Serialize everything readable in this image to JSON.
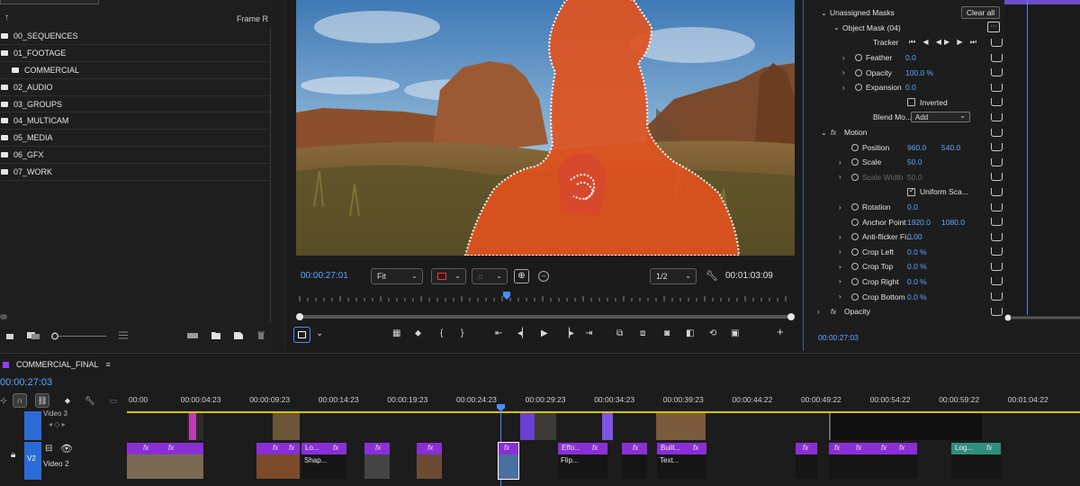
{
  "project": {
    "column_header": "Frame R",
    "bins": [
      {
        "name": "00_SEQUENCES",
        "child": false
      },
      {
        "name": "01_FOOTAGE",
        "child": false
      },
      {
        "name": "COMMERCIAL",
        "child": true
      },
      {
        "name": "02_AUDIO",
        "child": false
      },
      {
        "name": "03_GROUPS",
        "child": false
      },
      {
        "name": "04_MULTICAM",
        "child": false
      },
      {
        "name": "05_MEDIA",
        "child": false
      },
      {
        "name": "06_GFX",
        "child": false
      },
      {
        "name": "07_WORK",
        "child": false
      }
    ]
  },
  "monitor": {
    "current_tc": "00:00:27:01",
    "duration_tc": "00:01:03:09",
    "zoom": "Fit",
    "resolution": "1/2"
  },
  "effects": {
    "clear_all": "Clear all",
    "rows": [
      {
        "twirl": "down",
        "label": "Unassigned Masks",
        "indent": 4
      },
      {
        "twirl": "down",
        "label": "Object Mask (04)",
        "indent": 18
      },
      {
        "label": "Tracker",
        "indent": 52,
        "tracker": true
      },
      {
        "twirl": "right",
        "stop": true,
        "label": "Feather",
        "value": "0.0",
        "indent": 42,
        "vx": 98
      },
      {
        "twirl": "right",
        "stop": true,
        "label": "Opacity",
        "value": "100.0 %",
        "indent": 42,
        "vx": 98
      },
      {
        "twirl": "right",
        "stop": true,
        "label": "Expansion",
        "value": "0.0",
        "indent": 42,
        "vx": 98
      },
      {
        "check": "off",
        "label": "Inverted",
        "indent": 114
      },
      {
        "label": "Blend Mo...",
        "indent": 52,
        "blend": "Add"
      },
      {
        "twirl": "down",
        "fx": true,
        "label": "Motion",
        "indent": 4
      },
      {
        "stop": true,
        "label": "Position",
        "value": "960.0",
        "value2": "540.0",
        "indent": 38,
        "vx": 100
      },
      {
        "twirl": "right",
        "stop": true,
        "label": "Scale",
        "value": "50.0",
        "indent": 38,
        "vx": 100
      },
      {
        "twirl": "right",
        "stop": true,
        "label": "Scale Width",
        "value": "50.0",
        "indent": 38,
        "vx": 100,
        "dim": true
      },
      {
        "check": "on",
        "label": "Uniform Sca...",
        "indent": 114
      },
      {
        "twirl": "right",
        "stop": true,
        "label": "Rotation",
        "value": "0.0",
        "indent": 38,
        "vx": 100
      },
      {
        "stop": true,
        "label": "Anchor Point",
        "value": "1920.0",
        "value2": "1080.0",
        "indent": 38,
        "vx": 100
      },
      {
        "twirl": "right",
        "stop": true,
        "label": "Anti-flicker Fi...",
        "value": "0.00",
        "indent": 38,
        "vx": 100
      },
      {
        "twirl": "right",
        "stop": true,
        "label": "Crop Left",
        "value": "0.0 %",
        "indent": 38,
        "vx": 100
      },
      {
        "twirl": "right",
        "stop": true,
        "label": "Crop Top",
        "value": "0.0 %",
        "indent": 38,
        "vx": 100
      },
      {
        "twirl": "right",
        "stop": true,
        "label": "Crop Right",
        "value": "0.0 %",
        "indent": 38,
        "vx": 100
      },
      {
        "twirl": "right",
        "stop": true,
        "label": "Crop Bottom",
        "value": "0.0 %",
        "indent": 38,
        "vx": 100
      },
      {
        "twirl": "right",
        "fx": true,
        "label": "Opacity",
        "indent": 4
      }
    ],
    "timecode": "00:00:27:03"
  },
  "timeline": {
    "sequence_name": "COMMERCIAL_FINAL",
    "current_tc": "00:00:27:03",
    "ruler": [
      "00:00",
      "00:00:04:23",
      "00:00:09:23",
      "00:00:14:23",
      "00:00:19:23",
      "00:00:24:23",
      "00:00:29:23",
      "00:00:34:23",
      "00:00:39:23",
      "00:00:44:22",
      "00:00:49:22",
      "00:00:54:22",
      "00:00:59:22",
      "00:01:04:22"
    ],
    "v3_label": "Video 3",
    "v2_label": "Video 2",
    "v2_target": "V2",
    "clip_names": {
      "lo": "Lo...",
      "shap": "Shap...",
      "effo": "Effo...",
      "flip": "Flip...",
      "built": "Built...",
      "text": "Text...",
      "log": "Log...",
      "fx": "fx"
    }
  },
  "colors": {
    "accent_blue": "#4a8cff",
    "timecode_blue": "#5aa8ff",
    "clip_purple": "#8a2fd6",
    "clip_teal": "#2f8f7c",
    "mask_orange": "#e0521e",
    "work_area_yellow": "#d6c400"
  }
}
